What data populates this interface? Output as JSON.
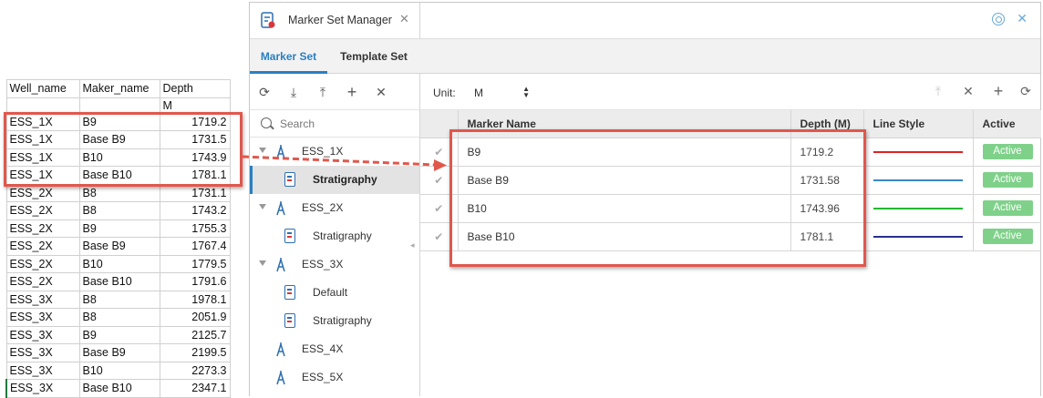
{
  "spreadsheet": {
    "headers": [
      "Well_name",
      "Maker_name",
      "Depth"
    ],
    "unit_row": [
      "",
      "",
      "M"
    ],
    "rows": [
      [
        "ESS_1X",
        "B9",
        "1719.2"
      ],
      [
        "ESS_1X",
        "Base B9",
        "1731.5"
      ],
      [
        "ESS_1X",
        "B10",
        "1743.9"
      ],
      [
        "ESS_1X",
        "Base B10",
        "1781.1"
      ],
      [
        "ESS_2X",
        "B8",
        "1731.1"
      ],
      [
        "ESS_2X",
        "B8",
        "1743.2"
      ],
      [
        "ESS_2X",
        "B9",
        "1755.3"
      ],
      [
        "ESS_2X",
        "Base B9",
        "1767.4"
      ],
      [
        "ESS_2X",
        "B10",
        "1779.5"
      ],
      [
        "ESS_2X",
        "Base B10",
        "1791.6"
      ],
      [
        "ESS_3X",
        "B8",
        "1978.1"
      ],
      [
        "ESS_3X",
        "B8",
        "2051.9"
      ],
      [
        "ESS_3X",
        "B9",
        "2125.7"
      ],
      [
        "ESS_3X",
        "Base B9",
        "2199.5"
      ],
      [
        "ESS_3X",
        "B10",
        "2273.3"
      ],
      [
        "ESS_3X",
        "Base B10",
        "2347.1"
      ]
    ]
  },
  "window": {
    "title": "Marker Set Manager",
    "close_glyph": "✕",
    "tabs": [
      {
        "label": "Marker Set",
        "active": true
      },
      {
        "label": "Template Set",
        "active": false
      }
    ]
  },
  "left_toolbar": {
    "icons": [
      "refresh-icon",
      "import-icon",
      "export-icon",
      "add-icon",
      "delete-icon"
    ],
    "glyphs": [
      "⟳",
      "⤓",
      "⤒",
      "+",
      "✕"
    ]
  },
  "search": {
    "placeholder": "Search"
  },
  "tree": [
    {
      "type": "well",
      "label": "ESS_1X",
      "expanded": true
    },
    {
      "type": "set",
      "label": "Stratigraphy",
      "selected": true
    },
    {
      "type": "well",
      "label": "ESS_2X",
      "expanded": true
    },
    {
      "type": "set",
      "label": "Stratigraphy",
      "selected": false
    },
    {
      "type": "well",
      "label": "ESS_3X",
      "expanded": true
    },
    {
      "type": "set",
      "label": "Default",
      "selected": false
    },
    {
      "type": "set",
      "label": "Stratigraphy",
      "selected": false
    },
    {
      "type": "well",
      "label": "ESS_4X",
      "expanded": false
    },
    {
      "type": "well",
      "label": "ESS_5X",
      "expanded": false
    }
  ],
  "right_toolbar": {
    "unit_label": "Unit:",
    "unit_value": "M",
    "icons": [
      "upload-icon",
      "clear-icon",
      "add-icon",
      "refresh-icon"
    ],
    "glyphs": [
      "⤒",
      "✕",
      "+",
      "⟳"
    ]
  },
  "grid": {
    "columns": [
      "",
      "Marker Name",
      "Depth (M)",
      "Line Style",
      "Active"
    ],
    "rows": [
      {
        "check": "✔",
        "name": "B9",
        "depth": "1719.2",
        "line_color": "#e02020",
        "active": "Active"
      },
      {
        "check": "✔",
        "name": "Base B9",
        "depth": "1731.58",
        "line_color": "#3a86c8",
        "active": "Active"
      },
      {
        "check": "✔",
        "name": "B10",
        "depth": "1743.96",
        "line_color": "#22b830",
        "active": "Active"
      },
      {
        "check": "✔",
        "name": "Base B10",
        "depth": "1781.1",
        "line_color": "#2a2f8f",
        "active": "Active"
      }
    ]
  },
  "colors": {
    "accent": "#2a7fc1",
    "annotation": "#e1574c",
    "active_badge": "#7fd18a"
  }
}
